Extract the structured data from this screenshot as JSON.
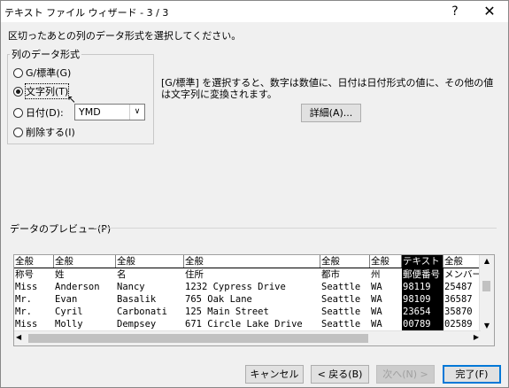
{
  "window": {
    "title": "テキスト ファイル ウィザード - 3 / 3",
    "help_label": "?",
    "close_label": "✕"
  },
  "instruction": "区切ったあとの列のデータ形式を選択してください。",
  "column_format": {
    "group_title": "列のデータ形式",
    "options": [
      {
        "label": "G/標準(G)",
        "checked": false
      },
      {
        "label": "文字列(T)",
        "checked": true
      },
      {
        "label": "日付(D):",
        "checked": false
      },
      {
        "label": "削除する(I)",
        "checked": false
      }
    ],
    "date_format": "YMD"
  },
  "description": "[G/標準] を選択すると、数字は数値に、日付は日付形式の値に、その他の値は文字列に変換されます。",
  "advanced_button": "詳細(A)...",
  "preview": {
    "label": "データのプレビュー(P)",
    "headers": [
      "全般",
      "全般",
      "全般",
      "全般",
      "全般",
      "全般",
      "テキスト",
      "全般"
    ],
    "rows": [
      [
        "称号",
        "姓",
        "名",
        "住所",
        "都市",
        "州",
        "郵便番号",
        "メンバー"
      ],
      [
        "Miss",
        "Anderson",
        "Nancy",
        "1232 Cypress Drive",
        "Seattle",
        "WA",
        "98119",
        "25487"
      ],
      [
        "Mr.",
        "Evan",
        "Basalik",
        "765 Oak Lane",
        "Seattle",
        "WA",
        "98109",
        "36587"
      ],
      [
        "Mr.",
        "Cyril",
        "Carbonati",
        "125 Main Street",
        "Seattle",
        "WA",
        "23654",
        "35870"
      ],
      [
        "Miss",
        "Molly",
        "Dempsey",
        "671 Circle Lake Drive",
        "Seattle",
        "WA",
        "00789",
        "02589"
      ]
    ]
  },
  "footer": {
    "cancel": "キャンセル",
    "back": "< 戻る(B)",
    "next": "次へ(N) >",
    "finish": "完了(F)"
  }
}
